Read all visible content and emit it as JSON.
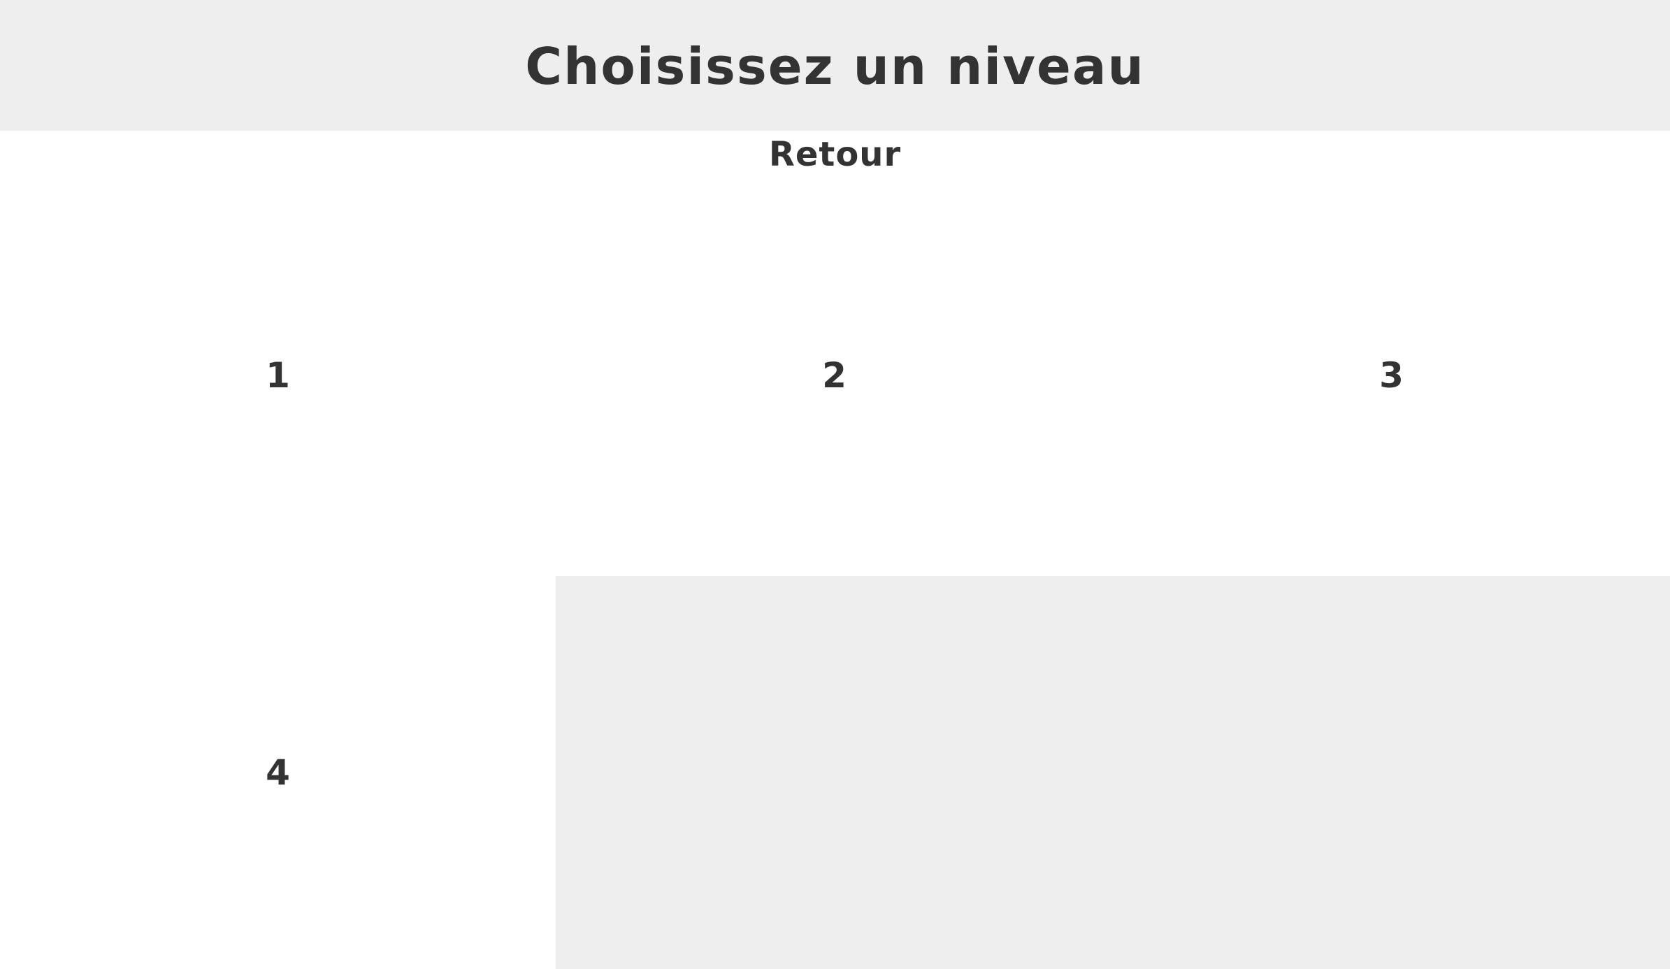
{
  "header": {
    "title": "Choisissez un niveau"
  },
  "nav": {
    "back_label": "Retour"
  },
  "levels": [
    {
      "label": "1"
    },
    {
      "label": "2"
    },
    {
      "label": "3"
    },
    {
      "label": "4"
    }
  ],
  "colors": {
    "header_bg": "#eeeeee",
    "page_bg": "#ffffff",
    "text": "#333333"
  }
}
